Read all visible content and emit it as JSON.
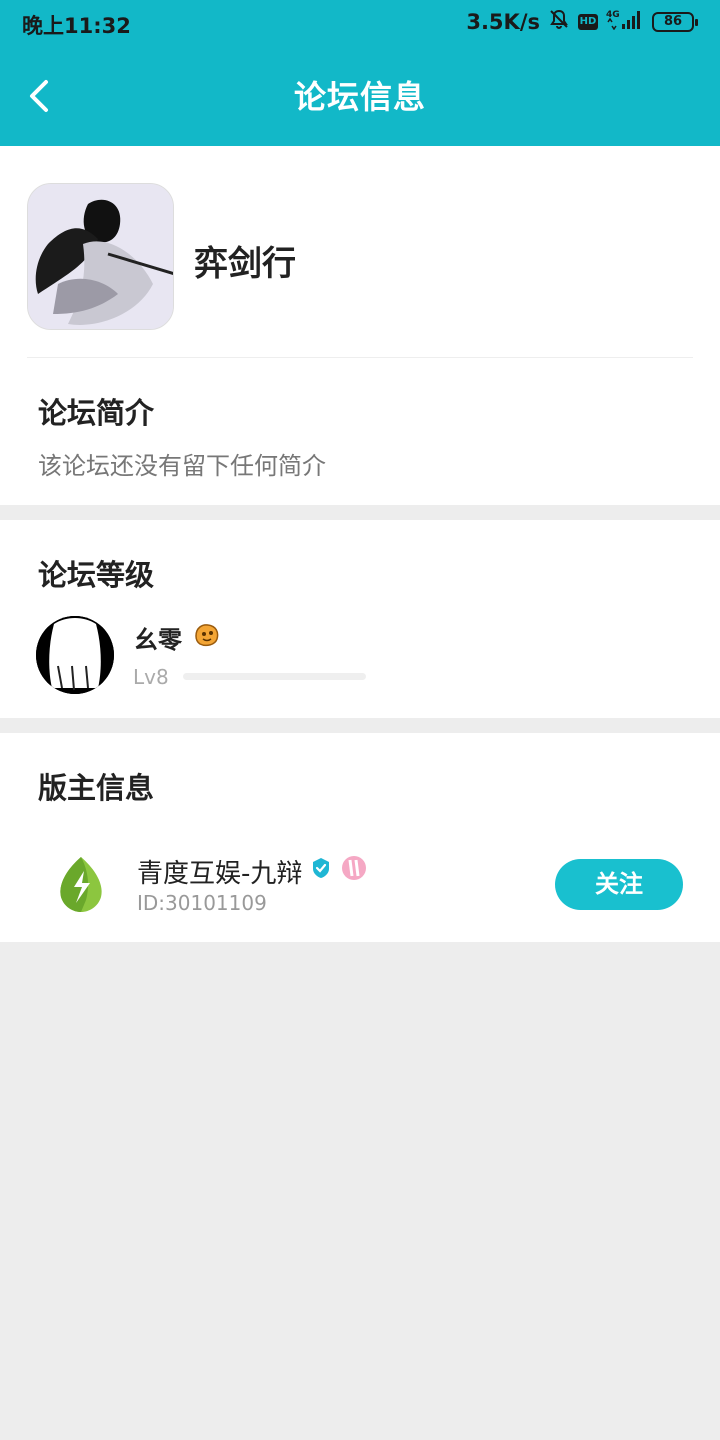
{
  "status_bar": {
    "time": "晚上11:32",
    "speed": "3.5K/s",
    "hd": "HD",
    "network": "4G",
    "battery": "86"
  },
  "header": {
    "title": "论坛信息",
    "accent_color": "#12b8c8"
  },
  "forum": {
    "name": "弈剑行",
    "intro_title": "论坛简介",
    "intro_text": "该论坛还没有留下任何简介"
  },
  "level": {
    "section_title": "论坛等级",
    "user_name": "幺零",
    "level_label": "Lv8",
    "progress": 0.0
  },
  "moderator": {
    "section_title": "版主信息",
    "name": "青度互娱-九辩",
    "id": "ID:30101109",
    "follow_label": "关注"
  }
}
